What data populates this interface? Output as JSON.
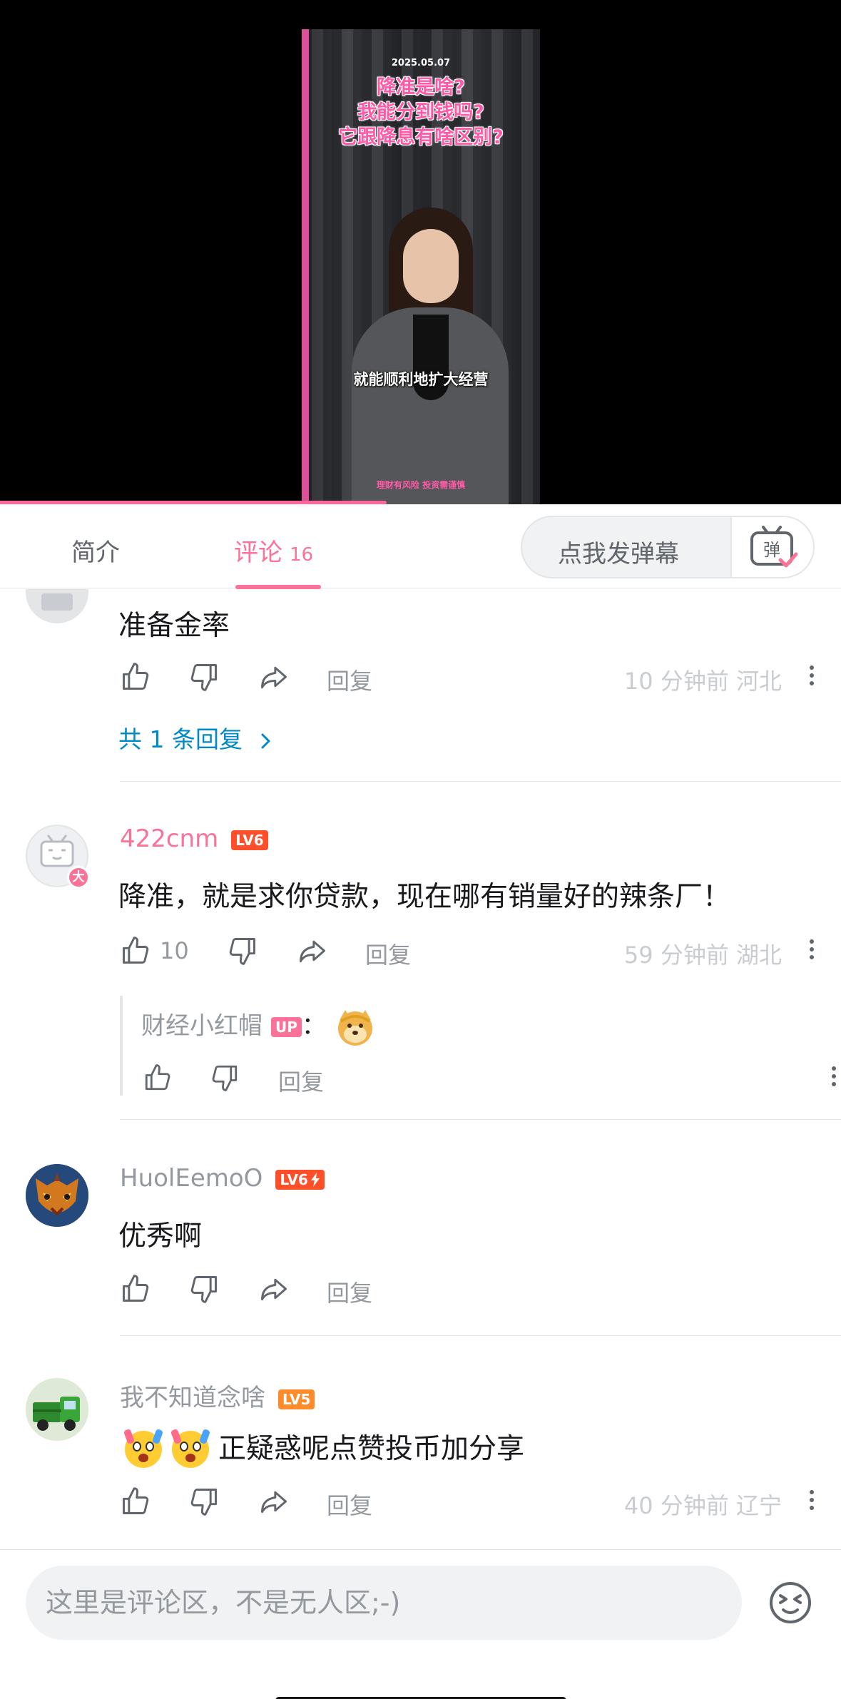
{
  "video": {
    "date": "2025.05.07",
    "headline": [
      "降准是啥?",
      "我能分到钱吗?",
      "它跟降息有啥区别?"
    ],
    "subtitle": "就能顺利地扩大经营",
    "disclaimer": "理财有风险 投资需谨慎",
    "progress_fraction": 0.46
  },
  "tabs": {
    "intro": "简介",
    "comments": "评论",
    "comment_count": "16",
    "danmaku_placeholder": "点我发弹幕",
    "danmaku_icon_char": "弹"
  },
  "comments": [
    {
      "text": "准备金率",
      "reply_label": "回复",
      "meta": "10 分钟前 河北",
      "sub_replies_link": "共 1 条回复"
    },
    {
      "name": "422cnm",
      "level": "LV6",
      "text": "降准，就是求你贷款，现在哪有销量好的辣条厂！",
      "like_count": "10",
      "reply_label": "回复",
      "meta": "59 分钟前 湖北",
      "avatar_badge": "大",
      "reply": {
        "name": "财经小红帽",
        "badge": "UP",
        "colon": "：",
        "reply_label": "回复"
      }
    },
    {
      "name": "HuolEemoO",
      "level": "LV6",
      "text": "优秀啊",
      "reply_label": "回复"
    },
    {
      "name": "我不知道念啥",
      "level": "LV5",
      "text": "正疑惑呢点赞投币加分享",
      "reply_label": "回复",
      "meta": "40 分钟前 辽宁"
    }
  ],
  "input": {
    "placeholder": "这里是评论区，不是无人区;-)"
  },
  "colors": {
    "accent": "#fb7299",
    "link": "#008ac5",
    "level6": "#ff4e2a",
    "level5": "#ff8b2a"
  }
}
